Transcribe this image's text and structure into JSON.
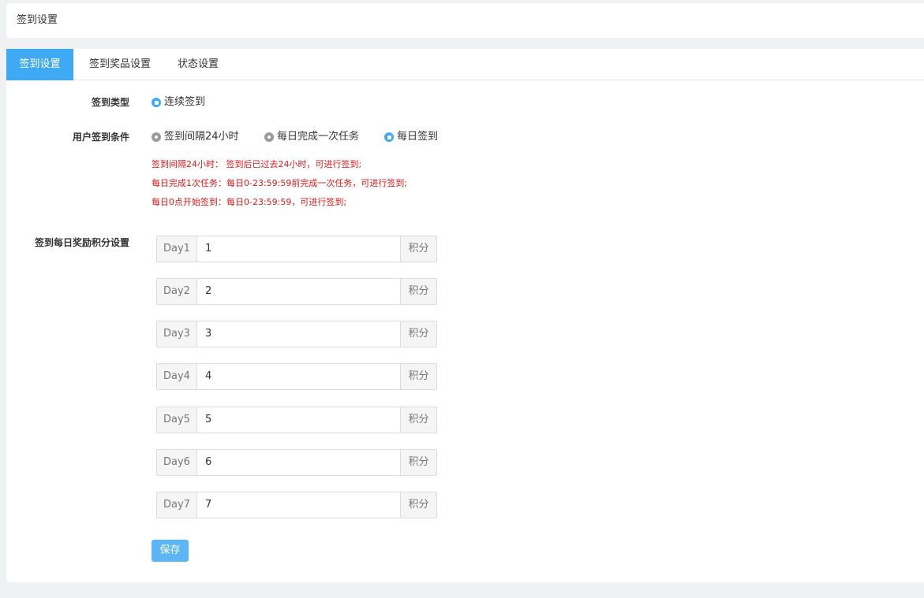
{
  "header": {
    "title": "签到设置"
  },
  "tabs": [
    {
      "label": "签到设置",
      "active": true
    },
    {
      "label": "签到奖品设置",
      "active": false
    },
    {
      "label": "状态设置",
      "active": false
    }
  ],
  "form": {
    "sign_type": {
      "label": "签到类型",
      "options": [
        {
          "label": "连续签到",
          "checked": true
        }
      ]
    },
    "condition": {
      "label": "用户签到条件",
      "options": [
        {
          "label": "签到间隔24小时",
          "checked": false
        },
        {
          "label": "每日完成一次任务",
          "checked": false
        },
        {
          "label": "每日签到",
          "checked": true
        }
      ]
    },
    "hints": [
      "签到间隔24小时： 签到后已过去24小时，可进行签到;",
      "每日完成1次任务：每日0-23:59:59前完成一次任务，可进行签到;",
      "每日0点开始签到：每日0-23:59:59，可进行签到;"
    ],
    "rewards": {
      "label": "签到每日奖励积分设置",
      "unit": "积分",
      "days": [
        {
          "prefix": "Day1",
          "value": "1"
        },
        {
          "prefix": "Day2",
          "value": "2"
        },
        {
          "prefix": "Day3",
          "value": "3"
        },
        {
          "prefix": "Day4",
          "value": "4"
        },
        {
          "prefix": "Day5",
          "value": "5"
        },
        {
          "prefix": "Day6",
          "value": "6"
        },
        {
          "prefix": "Day7",
          "value": "7"
        }
      ]
    },
    "save_label": "保存"
  },
  "colors": {
    "accent": "#40a9f4",
    "hint": "#e0191a",
    "radio_unchecked": "#9b9b9b"
  }
}
